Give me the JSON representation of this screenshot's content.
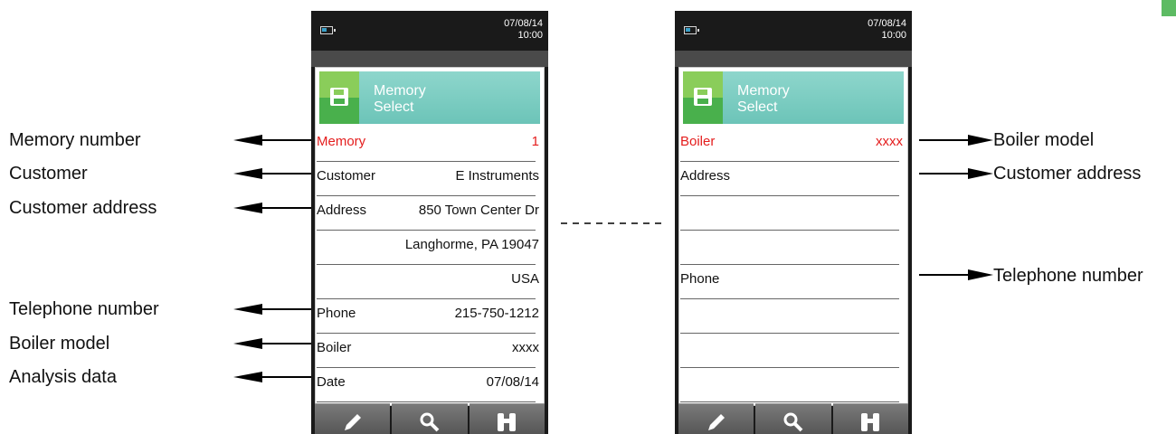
{
  "callouts": {
    "left": [
      "Memory number",
      "Customer",
      "Customer address",
      "Telephone number",
      "Boiler model",
      "Analysis data"
    ],
    "right": [
      "Boiler model",
      "Customer address",
      "Telephone number"
    ]
  },
  "device_left": {
    "date": "07/08/14",
    "time": "10:00",
    "header": {
      "line1": "Memory",
      "line2": "Select"
    },
    "rows": [
      {
        "label": "Memory",
        "value": "1",
        "highlight": true
      },
      {
        "label": "Customer",
        "value": "E Instruments"
      },
      {
        "label": "Address",
        "value": "850 Town Center Dr"
      },
      {
        "label": "",
        "value": "Langhorme, PA  19047"
      },
      {
        "label": "",
        "value": "USA"
      },
      {
        "label": "Phone",
        "value": "215-750-1212"
      },
      {
        "label": "Boiler",
        "value": "xxxx"
      },
      {
        "label": "Date",
        "value": "07/08/14"
      }
    ]
  },
  "device_right": {
    "date": "07/08/14",
    "time": "10:00",
    "header": {
      "line1": "Memory",
      "line2": "Select"
    },
    "rows": [
      {
        "label": "Boiler",
        "value": "xxxx",
        "highlight": true
      },
      {
        "label": "Address",
        "value": ""
      },
      {
        "label": "",
        "value": ""
      },
      {
        "label": "",
        "value": ""
      },
      {
        "label": "Phone",
        "value": ""
      },
      {
        "label": "",
        "value": ""
      },
      {
        "label": "",
        "value": ""
      },
      {
        "label": "",
        "value": ""
      }
    ]
  },
  "toolbar_icons": [
    "pencil-icon",
    "magnifier-icon",
    "binoculars-icon"
  ],
  "colors": {
    "highlight": "#e41d1d",
    "header": "#7ccdc1",
    "save_top": "#8acd5a",
    "save_bottom": "#49b04c",
    "corner_tab": "#5dbb63"
  }
}
